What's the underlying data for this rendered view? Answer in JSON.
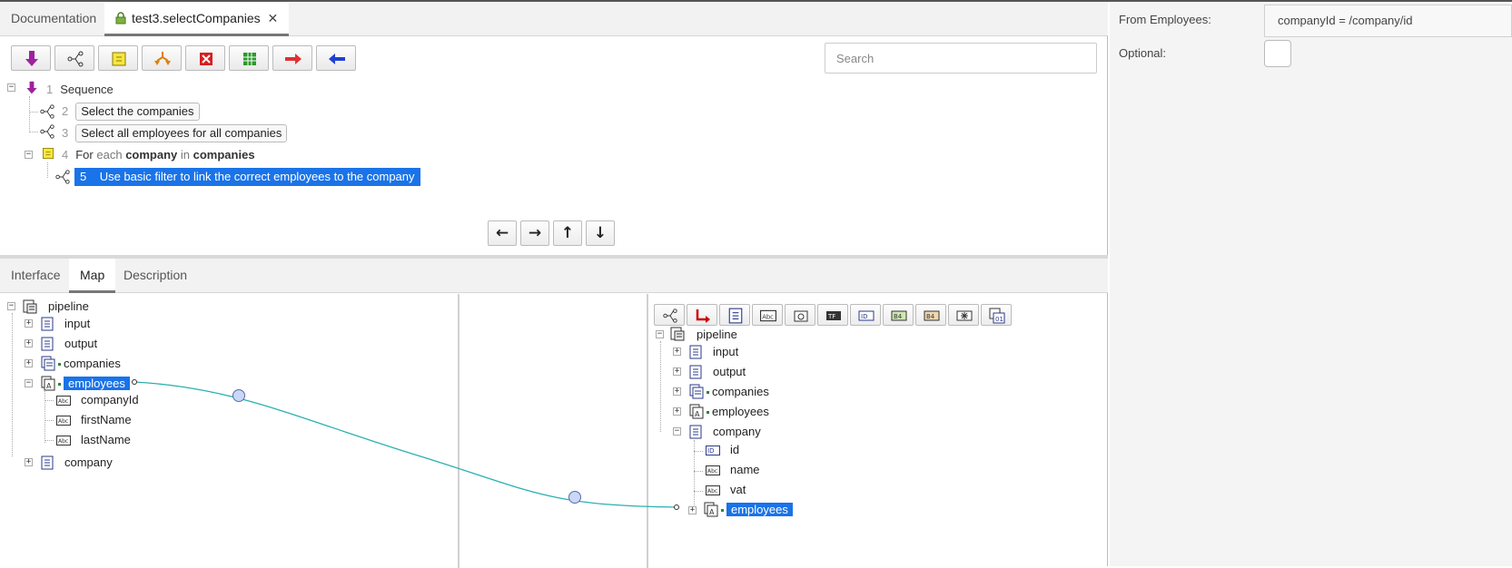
{
  "tabs": {
    "documentation": "Documentation",
    "active": "test3.selectCompanies",
    "close": "✕"
  },
  "search": {
    "placeholder": "Search"
  },
  "toolbar_icons": [
    "invoke-icon",
    "map-icon",
    "loop-icon",
    "branch-icon",
    "exit-icon",
    "repeat-icon",
    "try-icon",
    "catch-icon"
  ],
  "flow": [
    {
      "num": "1",
      "label": "Sequence"
    },
    {
      "num": "2",
      "label": "Select the companies"
    },
    {
      "num": "3",
      "label": "Select all employees for all companies"
    },
    {
      "num": "4",
      "for": "For",
      "each": "each",
      "var": "company",
      "in": "in",
      "list": "companies"
    },
    {
      "num": "5",
      "label": "Use basic filter to link the correct employees to the company"
    }
  ],
  "nav": {
    "left": "←",
    "right": "→",
    "up": "↑",
    "down": "↓"
  },
  "bottom_tabs": {
    "interface": "Interface",
    "map": "Map",
    "description": "Description"
  },
  "left_tree": {
    "root": "pipeline",
    "input": "input",
    "output": "output",
    "companies": "companies",
    "employees": "employees",
    "companyId": "companyId",
    "firstName": "firstName",
    "lastName": "lastName",
    "company": "company"
  },
  "right_tree": {
    "root": "pipeline",
    "input": "input",
    "output": "output",
    "companies": "companies",
    "employees": "employees",
    "company": "company",
    "id": "id",
    "name": "name",
    "vat": "vat",
    "employees2": "employees"
  },
  "props": {
    "from_label": "From Employees:",
    "from_value": "companyId = /company/id",
    "optional_label": "Optional:"
  },
  "colors": {
    "selection": "#1a73e8",
    "link": "#2ab0b0"
  }
}
